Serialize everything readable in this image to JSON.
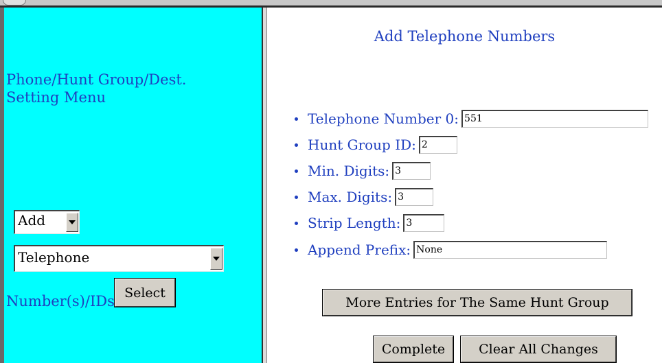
{
  "left_panel": {
    "menu_title": "Phone/Hunt Group/Dest. Setting Menu",
    "action_select": {
      "value": "Add"
    },
    "type_select": {
      "value": "Telephone"
    },
    "numbers_label": "Number(s)/IDs",
    "select_button": "Select"
  },
  "main": {
    "title": "Add Telephone Numbers",
    "fields": [
      {
        "label": "Telephone Number 0:",
        "value": "551"
      },
      {
        "label": "Hunt Group ID:",
        "value": "2"
      },
      {
        "label": "Min. Digits:",
        "value": "3"
      },
      {
        "label": "Max. Digits:",
        "value": "3"
      },
      {
        "label": "Strip Length:",
        "value": "3"
      },
      {
        "label": "Append Prefix:",
        "value": "None"
      }
    ],
    "more_entries_button": "More Entries for The Same Hunt Group",
    "complete_button": "Complete",
    "clear_button": "Clear All Changes"
  },
  "colors": {
    "left_background": "#00ffff",
    "text_blue": "#1f3fbf"
  },
  "icons": {
    "dropdown": "chevron-down-icon",
    "bullet": "bullet-icon"
  }
}
